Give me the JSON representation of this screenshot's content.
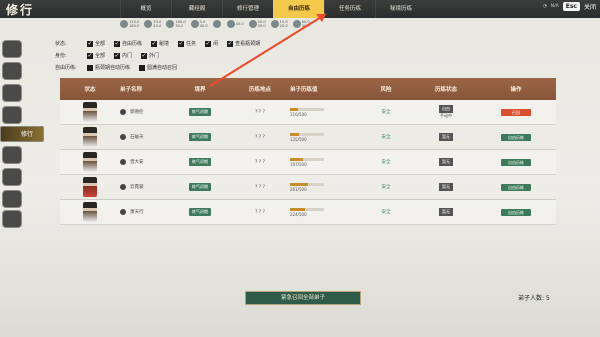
{
  "title": "修行",
  "tabs": [
    {
      "label": "概览",
      "active": false
    },
    {
      "label": "藏经阁",
      "active": false
    },
    {
      "label": "修行管理",
      "active": false
    },
    {
      "label": "自由历练",
      "active": true
    },
    {
      "label": "任务历练",
      "active": false
    },
    {
      "label": "秘境历练",
      "active": false
    }
  ],
  "status": {
    "wifi": "",
    "battery": "N/A",
    "esc": "Esc",
    "lang": "关闭"
  },
  "resources": [
    {
      "top": "120.0",
      "bottom": "180.0"
    },
    {
      "top": "33.0",
      "bottom": "40.0"
    },
    {
      "top": "160.0",
      "bottom": "35.0"
    },
    {
      "top": "0.0",
      "bottom": "40.0"
    },
    {
      "top": "",
      "bottom": ""
    },
    {
      "top": "40.0",
      "bottom": ""
    },
    {
      "top": "20.0",
      "bottom": "30.0"
    },
    {
      "top": "15.0",
      "bottom": "20.0"
    },
    {
      "top": "60.0",
      "bottom": "30.0"
    }
  ],
  "sidebar": {
    "active_label": "修行"
  },
  "filters": {
    "status_label": "状态:",
    "status_opts": [
      "全部",
      "自由历练",
      "秘境",
      "任务",
      "闲"
    ],
    "extra_opts": [
      "查看瓶颈期"
    ],
    "identity_label": "身份:",
    "identity_opts": [
      "全部",
      "内门",
      "外门"
    ],
    "free_label": "自由历练:",
    "free_opts": [
      "瓶颈期自动历练",
      "圆满自动召回"
    ]
  },
  "table": {
    "headers": [
      "状态",
      "弟子名称",
      "境界",
      "历练地点",
      "弟子历练值",
      "风险",
      "历练状态",
      "操作"
    ],
    "rows": [
      {
        "name": "郭德伦",
        "realm": "练气初期",
        "place": "? ? ?",
        "progress": 0.23,
        "value": "116/500",
        "risk": "安全",
        "state": "自由",
        "sub": "手动中",
        "action": "召回",
        "danger": true,
        "red": false
      },
      {
        "name": "石破天",
        "realm": "练气初期",
        "place": "? ? ?",
        "progress": 0.27,
        "value": "135/500",
        "risk": "安全",
        "state": "暂无",
        "sub": "",
        "action": "自由历练",
        "danger": false,
        "red": false
      },
      {
        "name": "曾大安",
        "realm": "练气初期",
        "place": "? ? ?",
        "progress": 0.39,
        "value": "197/500",
        "risk": "安全",
        "state": "暂无",
        "sub": "",
        "action": "自由历练",
        "danger": false,
        "red": false
      },
      {
        "name": "云霓裳",
        "realm": "练气初期",
        "place": "? ? ?",
        "progress": 0.52,
        "value": "261/500",
        "risk": "安全",
        "state": "暂无",
        "sub": "",
        "action": "自由历练",
        "danger": false,
        "red": true
      },
      {
        "name": "萧天行",
        "realm": "练气初期",
        "place": "? ? ?",
        "progress": 0.45,
        "value": "224/500",
        "risk": "安全",
        "state": "暂无",
        "sub": "",
        "action": "自由历练",
        "danger": false,
        "red": false
      }
    ]
  },
  "recall_all": "紧急召回全部弟子",
  "count_label": "弟子人数:",
  "count_value": "5"
}
